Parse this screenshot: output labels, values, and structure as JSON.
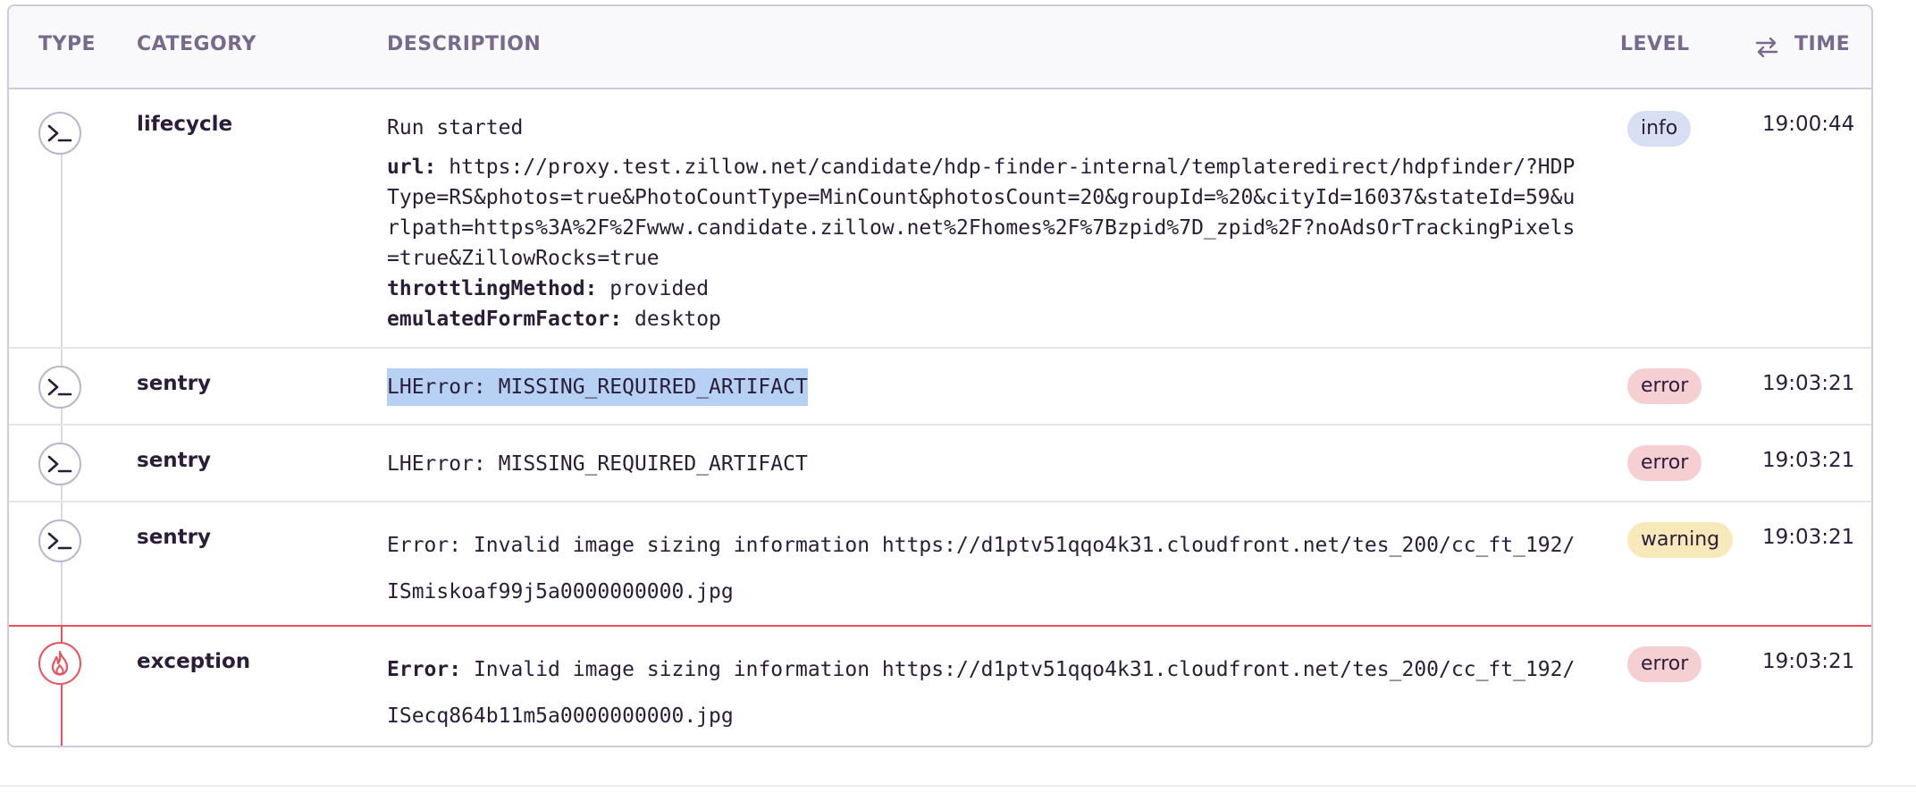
{
  "header": {
    "type": "TYPE",
    "category": "CATEGORY",
    "description": "DESCRIPTION",
    "level": "LEVEL",
    "time": "TIME",
    "sort_icon": "swap-arrows-icon"
  },
  "rows": [
    {
      "type_icon": "terminal-icon",
      "category": "lifecycle",
      "description": "Run started",
      "fields": [
        {
          "key": "url:",
          "value": "https://proxy.test.zillow.net/candidate/hdp-finder-internal/templateredirect/hdpfinder/?HDPType=RS&photos=true&PhotoCountType=MinCount&photosCount=20&groupId=%20&cityId=16037&stateId=59&urlpath=https%3A%2F%2Fwww.candidate.zillow.net%2Fhomes%2F%7Bzpid%7D_zpid%2F?noAdsOrTrackingPixels=true&ZillowRocks=true"
        },
        {
          "key": "throttlingMethod:",
          "value": "provided"
        },
        {
          "key": "emulatedFormFactor:",
          "value": "desktop"
        }
      ],
      "level": "info",
      "time": "19:00:44"
    },
    {
      "type_icon": "terminal-icon",
      "category": "sentry",
      "description": "LHError: MISSING_REQUIRED_ARTIFACT",
      "level": "error",
      "time": "19:03:21"
    },
    {
      "type_icon": "terminal-icon",
      "category": "sentry",
      "description": "LHError: MISSING_REQUIRED_ARTIFACT",
      "level": "error",
      "time": "19:03:21"
    },
    {
      "type_icon": "terminal-icon",
      "category": "sentry",
      "description": "Error: Invalid image sizing information https://d1ptv51qqo4k31.cloudfront.net/tes_200/cc_ft_192/ISmiskoaf99j5a0000000000.jpg",
      "level": "warning",
      "time": "19:03:21"
    },
    {
      "type_icon": "fire-icon",
      "category": "exception",
      "error_key": "Error:",
      "description": "Invalid image sizing information https://d1ptv51qqo4k31.cloudfront.net/tes_200/cc_ft_192/ISecq864b11m5a0000000000.jpg",
      "level": "error",
      "time": "19:03:21"
    }
  ],
  "colors": {
    "info": "#d8def3",
    "error": "#f6cfd3",
    "warning": "#f8e9bb",
    "exception": "#e8535f",
    "selection": "#b7d1f5"
  }
}
